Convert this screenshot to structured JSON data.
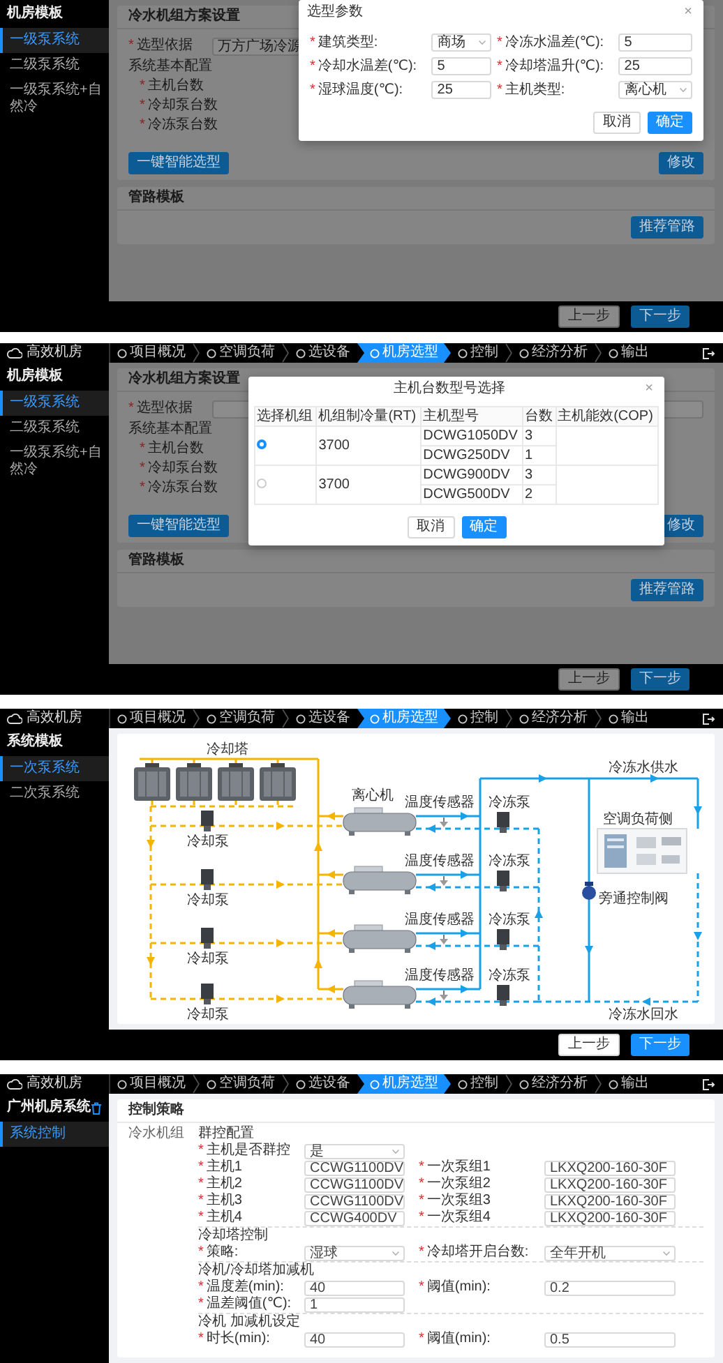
{
  "screens": [
    {
      "kind": "params_modal",
      "sidebar": {
        "title": "机房模板",
        "items": [
          {
            "label": "一级泵系统",
            "selected": true
          },
          {
            "label": "二级泵系统",
            "selected": false
          },
          {
            "label": "一级泵系统+自然冷",
            "selected": false
          }
        ]
      },
      "scheme_card": {
        "title": "冷水机组方案设置",
        "basis": {
          "mark": "*",
          "label": "选型依据",
          "value": "万方广场冷源"
        },
        "config_label": "系统基本配置",
        "config_fields": [
          {
            "mark": "*",
            "label": "主机台数"
          },
          {
            "mark": "*",
            "label": "冷却泵台数"
          },
          {
            "mark": "*",
            "label": "冷冻泵台数"
          }
        ],
        "smart_button": "一键智能选型",
        "edit_button": "修改"
      },
      "pipe_card": {
        "title": "管路模板",
        "button": "推荐管路"
      },
      "footer": {
        "prev": "上一步",
        "next": "下一步"
      },
      "modal": {
        "title": "选型参数",
        "close": "×",
        "fields": [
          {
            "mark": "*",
            "label": "建筑类型:",
            "value": "商场",
            "kind": "select"
          },
          {
            "mark": "*",
            "label": "冷冻水温差(℃):",
            "value": "5",
            "kind": "input"
          },
          {
            "mark": "*",
            "label": "冷却水温差(℃):",
            "value": "5",
            "kind": "input"
          },
          {
            "mark": "*",
            "label": "冷却塔温升(℃):",
            "value": "25",
            "kind": "input"
          },
          {
            "mark": "*",
            "label": "湿球温度(℃):",
            "value": "25",
            "kind": "input"
          },
          {
            "mark": "*",
            "label": "主机类型:",
            "value": "离心机",
            "kind": "select"
          }
        ],
        "cancel": "取消",
        "ok": "确定"
      }
    },
    {
      "kind": "table_modal",
      "nav": {
        "logo": "高效机房",
        "steps": [
          {
            "label": "项目概况",
            "selected": false
          },
          {
            "label": "空调负荷",
            "selected": false
          },
          {
            "label": "选设备",
            "selected": false
          },
          {
            "label": "机房选型",
            "selected": true
          },
          {
            "label": "控制",
            "selected": false
          },
          {
            "label": "经济分析",
            "selected": false
          },
          {
            "label": "输出",
            "selected": false
          }
        ]
      },
      "sidebar": {
        "title": "机房模板",
        "items": [
          {
            "label": "一级泵系统",
            "selected": true
          },
          {
            "label": "二级泵系统",
            "selected": false
          },
          {
            "label": "一级泵系统+自然冷",
            "selected": false
          }
        ]
      },
      "scheme_card": {
        "title": "冷水机组方案设置",
        "basis": {
          "mark": "*",
          "label": "选型依据"
        },
        "config_label": "系统基本配置",
        "config_fields": [
          {
            "mark": "*",
            "label": "主机台数"
          },
          {
            "mark": "*",
            "label": "冷却泵台数"
          },
          {
            "mark": "*",
            "label": "冷冻泵台数"
          }
        ],
        "smart_button": "一键智能选型",
        "edit_button": "修改"
      },
      "pipe_card": {
        "title": "管路模板",
        "button": "推荐管路"
      },
      "footer": {
        "prev": "上一步",
        "next": "下一步"
      },
      "modal": {
        "title": "主机台数型号选择",
        "close": "×",
        "columns": [
          "选择机组",
          "机组制冷量(RT)",
          "主机型号",
          "台数",
          "主机能效(COP)"
        ],
        "groups": [
          {
            "selected": true,
            "capacity": "3700",
            "rows": [
              {
                "model": "DCWG1050DV",
                "count": "3"
              },
              {
                "model": "DCWG250DV",
                "count": "1"
              }
            ]
          },
          {
            "selected": false,
            "capacity": "3700",
            "rows": [
              {
                "model": "DCWG900DV",
                "count": "3"
              },
              {
                "model": "DCWG500DV",
                "count": "2"
              }
            ]
          }
        ],
        "cancel": "取消",
        "ok": "确定"
      }
    },
    {
      "kind": "diagram",
      "nav": {
        "logo": "高效机房",
        "steps": [
          {
            "label": "项目概况",
            "selected": false
          },
          {
            "label": "空调负荷",
            "selected": false
          },
          {
            "label": "选设备",
            "selected": false
          },
          {
            "label": "机房选型",
            "selected": true
          },
          {
            "label": "控制",
            "selected": false
          },
          {
            "label": "经济分析",
            "selected": false
          },
          {
            "label": "输出",
            "selected": false
          }
        ]
      },
      "sidebar": {
        "title": "系统模板",
        "items": [
          {
            "label": "一次泵系统",
            "selected": true
          },
          {
            "label": "二次泵系统",
            "selected": false
          }
        ]
      },
      "diagram": {
        "cooling_tower": "冷却塔",
        "chiller": "离心机",
        "sensors": [
          "温度传感器",
          "温度传感器",
          "温度传感器",
          "温度传感器"
        ],
        "chilled_pumps": [
          "冷冻泵",
          "冷冻泵",
          "冷冻泵",
          "冷冻泵"
        ],
        "cooling_pumps": [
          "冷却泵",
          "冷却泵",
          "冷却泵",
          "冷却泵"
        ],
        "bypass": "旁通控制阀",
        "load": "空调负荷侧",
        "supply": "冷冻水供水",
        "return": "冷冻水回水"
      },
      "footer": {
        "prev": "上一步",
        "next": "下一步"
      }
    },
    {
      "kind": "control_form",
      "nav": {
        "logo": "高效机房",
        "steps": [
          {
            "label": "项目概况",
            "selected": false
          },
          {
            "label": "空调负荷",
            "selected": false
          },
          {
            "label": "选设备",
            "selected": false
          },
          {
            "label": "机房选型",
            "selected": true
          },
          {
            "label": "控制",
            "selected": false
          },
          {
            "label": "经济分析",
            "selected": false
          },
          {
            "label": "输出",
            "selected": false
          }
        ]
      },
      "sidebar": {
        "title": "广州机房系统",
        "items": [
          {
            "label": "系统控制",
            "selected": true
          }
        ]
      },
      "card": {
        "title": "控制策略",
        "group_label": "冷水机组",
        "sections": [
          {
            "heading": "群控配置",
            "rows": [
              [
                {
                  "mark": "*",
                  "label": "主机是否群控",
                  "value": "是",
                  "kind": "select"
                }
              ],
              [
                {
                  "mark": "*",
                  "label": "主机1",
                  "value": "CCWG1100DV",
                  "kind": "select"
                },
                {
                  "mark": "*",
                  "label": "一次泵组1",
                  "value": "LKXQ200-160-30F",
                  "kind": "select"
                }
              ],
              [
                {
                  "mark": "*",
                  "label": "主机2",
                  "value": "CCWG1100DV",
                  "kind": "select"
                },
                {
                  "mark": "*",
                  "label": "一次泵组2",
                  "value": "LKXQ200-160-30F",
                  "kind": "select"
                }
              ],
              [
                {
                  "mark": "*",
                  "label": "主机3",
                  "value": "CCWG1100DV",
                  "kind": "select"
                },
                {
                  "mark": "*",
                  "label": "一次泵组3",
                  "value": "LKXQ200-160-30F",
                  "kind": "select"
                }
              ],
              [
                {
                  "mark": "*",
                  "label": "主机4",
                  "value": "CCWG400DV",
                  "kind": "select"
                },
                {
                  "mark": "*",
                  "label": "一次泵组4",
                  "value": "LKXQ200-160-30F",
                  "kind": "select"
                }
              ]
            ]
          },
          {
            "heading": "冷却塔控制",
            "rows": [
              [
                {
                  "mark": "*",
                  "label": "策略:",
                  "value": "湿球",
                  "kind": "select"
                },
                {
                  "mark": "*",
                  "label": "冷却塔开启台数:",
                  "value": "全年开机",
                  "kind": "select"
                }
              ]
            ]
          },
          {
            "heading": "冷机/冷却塔加减机",
            "rows": [
              [
                {
                  "mark": "*",
                  "label": "温度差(min):",
                  "value": "40",
                  "kind": "input"
                },
                {
                  "mark": "*",
                  "label": "阈值(min):",
                  "value": "0.2",
                  "kind": "input"
                }
              ],
              [
                {
                  "mark": "*",
                  "label": "温差阈值(℃):",
                  "value": "1",
                  "kind": "input"
                }
              ]
            ]
          },
          {
            "heading": "冷机 加减机设定",
            "rows": [
              [
                {
                  "mark": "*",
                  "label": "时长(min):",
                  "value": "40",
                  "kind": "input"
                },
                {
                  "mark": "*",
                  "label": "阈值(min):",
                  "value": "0.5",
                  "kind": "input"
                }
              ]
            ]
          }
        ]
      }
    }
  ]
}
